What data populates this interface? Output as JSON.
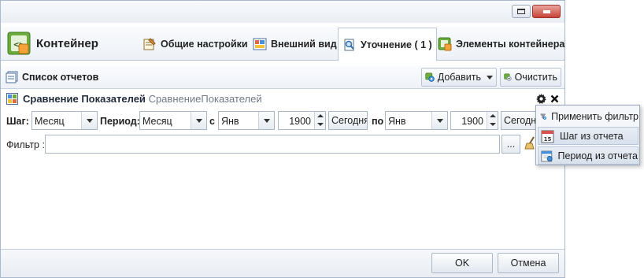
{
  "app": {
    "title": "Контейнер",
    "icon": "code-container-icon"
  },
  "tabs": [
    {
      "label": "Общие настройки",
      "icon": "settings-note-icon",
      "active": false
    },
    {
      "label": "Внешний вид",
      "icon": "appearance-icon",
      "active": false
    },
    {
      "label": "Уточнение ( 1 )",
      "icon": "refinement-filter-icon",
      "active": true
    },
    {
      "label": "Элементы контейнера",
      "icon": "container-elements-icon",
      "active": false
    }
  ],
  "toolbar": {
    "title": "Список отчетов",
    "add_label": "Добавить",
    "clear_label": "Очистить"
  },
  "panel": {
    "title": "Сравнение Показателей",
    "subtitle": "СравнениеПоказателей"
  },
  "filters": {
    "step_label": "Шаг:",
    "step_value": "Месяц",
    "period_label": "Период:",
    "period_value": "Месяц",
    "from_label": "с",
    "from_month": "Янв",
    "from_year": "1900",
    "from_today": "Сегодня",
    "to_label": "по",
    "to_month": "Янв",
    "to_year": "1900",
    "to_today": "Сегодня",
    "filter_label": "Фильтр :",
    "filter_value": "",
    "browse_label": "..."
  },
  "context_menu": [
    {
      "label": "Применить фильтр",
      "icon": "apply-filter-icon",
      "highlighted": false
    },
    {
      "label": "Шаг из отчета",
      "icon": "step-calendar-icon",
      "highlighted": true
    },
    {
      "label": "Период из отчета",
      "icon": "period-calendar-icon",
      "highlighted": true
    }
  ],
  "footer": {
    "ok_label": "OK",
    "cancel_label": "Отмена"
  },
  "colors": {
    "accent": "#4a7ebb",
    "border": "#a9b8cc",
    "active_tab": "#ffffff"
  }
}
